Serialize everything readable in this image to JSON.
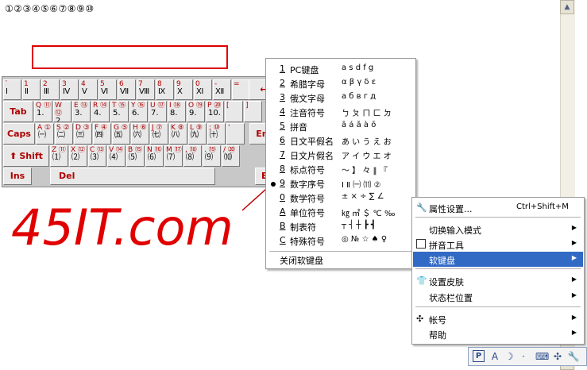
{
  "document": {
    "text": "①②③④⑤⑥⑦⑧⑨⑩"
  },
  "scrollbar": {
    "up": "▲",
    "down": "▼"
  },
  "keyboard": {
    "row1": [
      {
        "t": "`",
        "b": "Ⅰ"
      },
      {
        "t": "1",
        "b": "Ⅱ"
      },
      {
        "t": "2",
        "b": "Ⅲ"
      },
      {
        "t": "3",
        "b": "Ⅳ"
      },
      {
        "t": "4",
        "b": "Ⅴ"
      },
      {
        "t": "5",
        "b": "Ⅵ"
      },
      {
        "t": "6",
        "b": "Ⅶ"
      },
      {
        "t": "7",
        "b": "Ⅷ"
      },
      {
        "t": "8",
        "b": "Ⅸ"
      },
      {
        "t": "9",
        "b": "Ⅹ"
      },
      {
        "t": "0",
        "b": "Ⅺ"
      },
      {
        "t": "-",
        "b": "Ⅻ"
      },
      {
        "t": "=",
        "b": ""
      }
    ],
    "backspace": "←",
    "tab": "Tab",
    "row2": [
      {
        "t": "Q ⑪",
        "b": "1."
      },
      {
        "t": "W ⑫",
        "b": "2."
      },
      {
        "t": "E ⑬",
        "b": "3."
      },
      {
        "t": "R ⑭",
        "b": "4."
      },
      {
        "t": "T ⑮",
        "b": "5."
      },
      {
        "t": "Y ⑯",
        "b": "6."
      },
      {
        "t": "U ⑰",
        "b": "7."
      },
      {
        "t": "I ⑱",
        "b": "8."
      },
      {
        "t": "O ⑲",
        "b": "9."
      },
      {
        "t": "P ⑳",
        "b": "10."
      },
      {
        "t": "[",
        "b": ""
      },
      {
        "t": "]",
        "b": ""
      }
    ],
    "caps": "Caps",
    "row3": [
      {
        "t": "A ①",
        "b": "㈠"
      },
      {
        "t": "S ②",
        "b": "㈡"
      },
      {
        "t": "D ③",
        "b": "㈢"
      },
      {
        "t": "F ④",
        "b": "㈣"
      },
      {
        "t": "G ⑤",
        "b": "㈤"
      },
      {
        "t": "H ⑥",
        "b": "㈥"
      },
      {
        "t": "J ⑦",
        "b": "㈦"
      },
      {
        "t": "K ⑧",
        "b": "㈧"
      },
      {
        "t": "L ⑨",
        "b": "㈨"
      },
      {
        "t": "; ⑩",
        "b": "㈩"
      },
      {
        "t": "'",
        "b": ""
      }
    ],
    "enter": "Ent",
    "shift": "Shift",
    "row4": [
      {
        "t": "Z ⑪",
        "b": "⑴"
      },
      {
        "t": "X ⑫",
        "b": "⑵"
      },
      {
        "t": "C ⑬",
        "b": "⑶"
      },
      {
        "t": "V ⑭",
        "b": "⑷"
      },
      {
        "t": "B ⑮",
        "b": "⑸"
      },
      {
        "t": "N ⑯",
        "b": "⑹"
      },
      {
        "t": "M ⑰",
        "b": "⑺"
      },
      {
        "t": ", ⑱",
        "b": "⑻"
      },
      {
        "t": ". ⑲",
        "b": "⑼"
      },
      {
        "t": "/ ⑳",
        "b": "⑽"
      }
    ],
    "ins": "Ins",
    "del": "Del",
    "esc": "Es"
  },
  "handwriting": {
    "text": "45IT.com",
    "color": "#e00000"
  },
  "softkb_menu": {
    "items": [
      {
        "n": "1",
        "label": "PC键盘",
        "sample": "a s d f g"
      },
      {
        "n": "2",
        "label": "希腊字母",
        "sample": "α β γ δ ε"
      },
      {
        "n": "3",
        "label": "俄文字母",
        "sample": "а б в г д"
      },
      {
        "n": "4",
        "label": "注音符号",
        "sample": "ㄅ ㄆ ㄇ ㄈ ㄉ"
      },
      {
        "n": "5",
        "label": "拼音",
        "sample": "ā á ǎ à ō"
      },
      {
        "n": "6",
        "label": "日文平假名",
        "sample": "あ い う え お"
      },
      {
        "n": "7",
        "label": "日文片假名",
        "sample": "ア イ ウ エ オ"
      },
      {
        "n": "8",
        "label": "标点符号",
        "sample": "～ 】 々 ‖ 『"
      },
      {
        "n": "9",
        "label": "数字序号",
        "sample": "Ⅰ Ⅱ ㈠ ⑾ ②"
      },
      {
        "n": "0",
        "label": "数学符号",
        "sample": "± × ÷ ∑ ∠"
      },
      {
        "n": "A",
        "label": "单位符号",
        "sample": "㎏ ㎡ ＄ ℃ ‰"
      },
      {
        "n": "B",
        "label": "制表符",
        "sample": "┬ ┤ ┼ ┣ ┫"
      },
      {
        "n": "C",
        "label": "特殊符号",
        "sample": "◎ № ☆ ♠ ♀"
      }
    ],
    "close": "关闭软键盘"
  },
  "context_menu": {
    "properties": "属性设置...",
    "properties_shortcut": "Ctrl+Shift+M",
    "switch_mode": "切换输入模式",
    "pinyin_tools": "拼音工具",
    "soft_keyboard": "软键盘",
    "skin": "设置皮肤",
    "status_position": "状态栏位置",
    "account": "帐号",
    "help": "帮助",
    "submenu_arrow": "▶",
    "highlight_color": "#316ac5"
  },
  "ime_bar": {
    "p_label": "P",
    "a_label": "A"
  }
}
